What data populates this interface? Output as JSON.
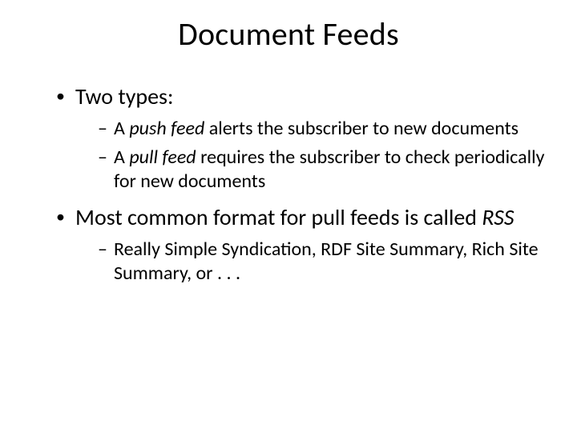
{
  "title": "Document Feeds",
  "bullets": [
    {
      "text": "Two types:",
      "sub": [
        {
          "pre": "A ",
          "em": "push feed",
          "post": " alerts the subscriber to new documents"
        },
        {
          "pre": "A ",
          "em": "pull feed",
          "post": " requires the subscriber to check periodically for new documents"
        }
      ]
    },
    {
      "pre": "Most common format for pull feeds is called ",
      "em": "RSS",
      "sub": [
        {
          "text": "Really Simple Syndication, RDF Site Summary, Rich Site Summary, or . . ."
        }
      ]
    }
  ]
}
